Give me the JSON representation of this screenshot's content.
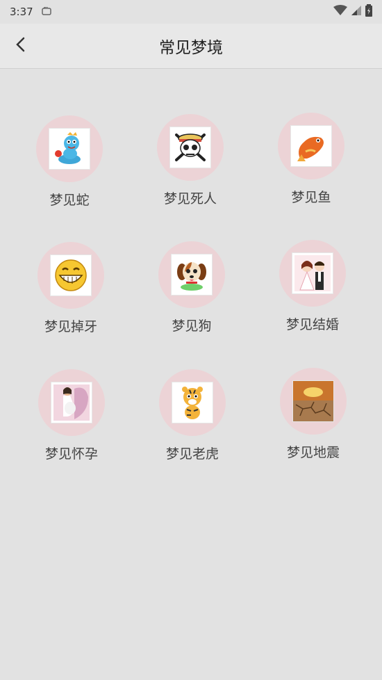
{
  "status": {
    "time": "3:37"
  },
  "header": {
    "title": "常见梦境"
  },
  "dreams": [
    {
      "label": "梦见蛇",
      "icon": "snake-icon"
    },
    {
      "label": "梦见死人",
      "icon": "skull-icon"
    },
    {
      "label": "梦见鱼",
      "icon": "fish-icon"
    },
    {
      "label": "梦见掉牙",
      "icon": "grin-face-icon"
    },
    {
      "label": "梦见狗",
      "icon": "puppy-icon"
    },
    {
      "label": "梦见结婚",
      "icon": "wedding-couple-icon"
    },
    {
      "label": "梦见怀孕",
      "icon": "pregnant-woman-icon"
    },
    {
      "label": "梦见老虎",
      "icon": "tiger-icon"
    },
    {
      "label": "梦见地震",
      "icon": "cracked-earth-icon"
    }
  ],
  "colors": {
    "background": "#e2e2e2",
    "circle": "#ecd3d6"
  }
}
